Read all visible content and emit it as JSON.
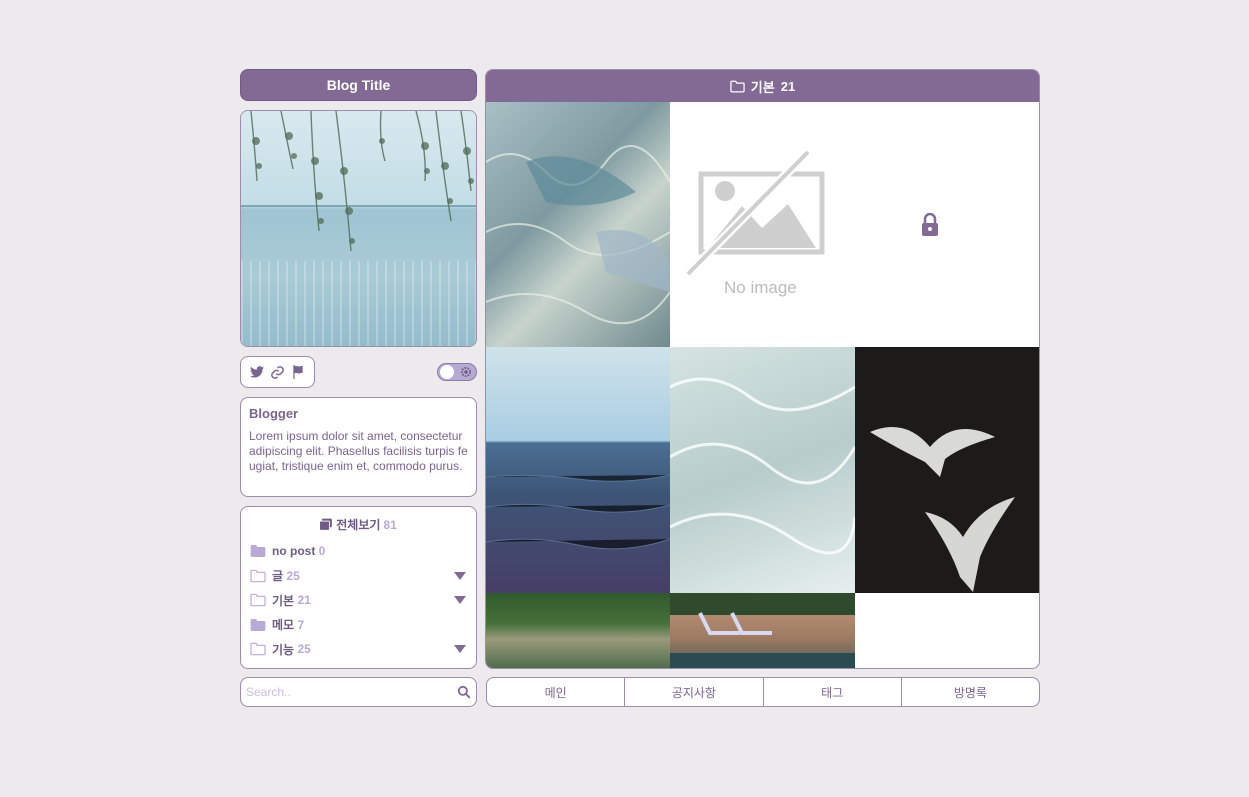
{
  "blog": {
    "title": "Blog Title"
  },
  "profile": {
    "name": "Blogger",
    "description": "Lorem ipsum dolor sit amet, consectetur adipiscing elit. Phasellus facilisis turpis feugiat, tristique enim et, commodo purus."
  },
  "sns_icons": [
    "twitter-icon",
    "link-icon",
    "flag-icon"
  ],
  "categories": {
    "all_label": "전체보기",
    "all_count": "81",
    "items": [
      {
        "label": "no post",
        "count": "0",
        "icon": "folder-filled",
        "expand": false
      },
      {
        "label": "글",
        "count": "25",
        "icon": "folder-outline",
        "expand": true
      },
      {
        "label": "기본",
        "count": "21",
        "icon": "folder-outline",
        "expand": true
      },
      {
        "label": "메모",
        "count": "7",
        "icon": "folder-filled",
        "expand": false
      },
      {
        "label": "기능",
        "count": "25",
        "icon": "folder-outline",
        "expand": true
      }
    ]
  },
  "search": {
    "placeholder": "Search.."
  },
  "post_grid": {
    "header_label": "기본",
    "header_count": "21",
    "no_image_text": "No image"
  },
  "menu": {
    "items": [
      "메인",
      "공지사항",
      "태그",
      "방명록"
    ]
  },
  "colors": {
    "accent": "#836a94",
    "border": "#9d8cab",
    "count": "#b8a9d6"
  }
}
